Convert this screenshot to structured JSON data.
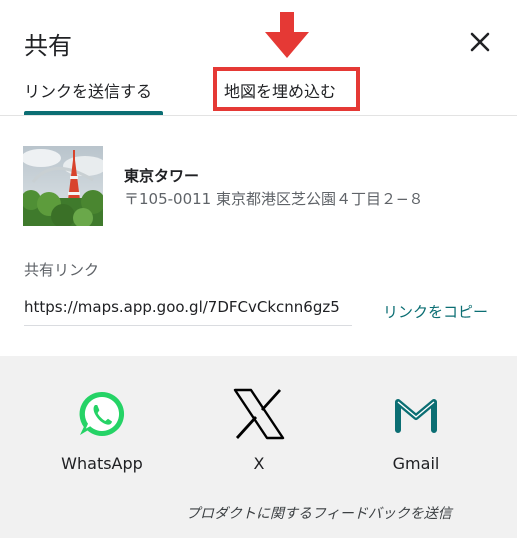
{
  "dialog": {
    "title": "共有",
    "tabs": [
      {
        "label": "リンクを送信する",
        "selected": true
      },
      {
        "label": "地図を埋め込む",
        "selected": false
      }
    ]
  },
  "place": {
    "name": "東京タワー",
    "address": "〒105-0011 東京都港区芝公園４丁目２−８"
  },
  "share_link": {
    "label": "共有リンク",
    "value": "https://maps.app.goo.gl/7DFCvCkcnn6gz5",
    "copy_label": "リンクをコピー"
  },
  "share_targets": [
    {
      "label": "WhatsApp",
      "icon": "whatsapp-icon",
      "color": "#25d366"
    },
    {
      "label": "X",
      "icon": "x-icon",
      "color": "#000000"
    },
    {
      "label": "Gmail",
      "icon": "gmail-icon",
      "color": "#0b6e73"
    }
  ],
  "feedback_label": "プロダクトに関するフィードバックを送信",
  "colors": {
    "accent": "#0b6e73",
    "annotation": "#e53935",
    "panel_bg": "#f1f1f1"
  }
}
